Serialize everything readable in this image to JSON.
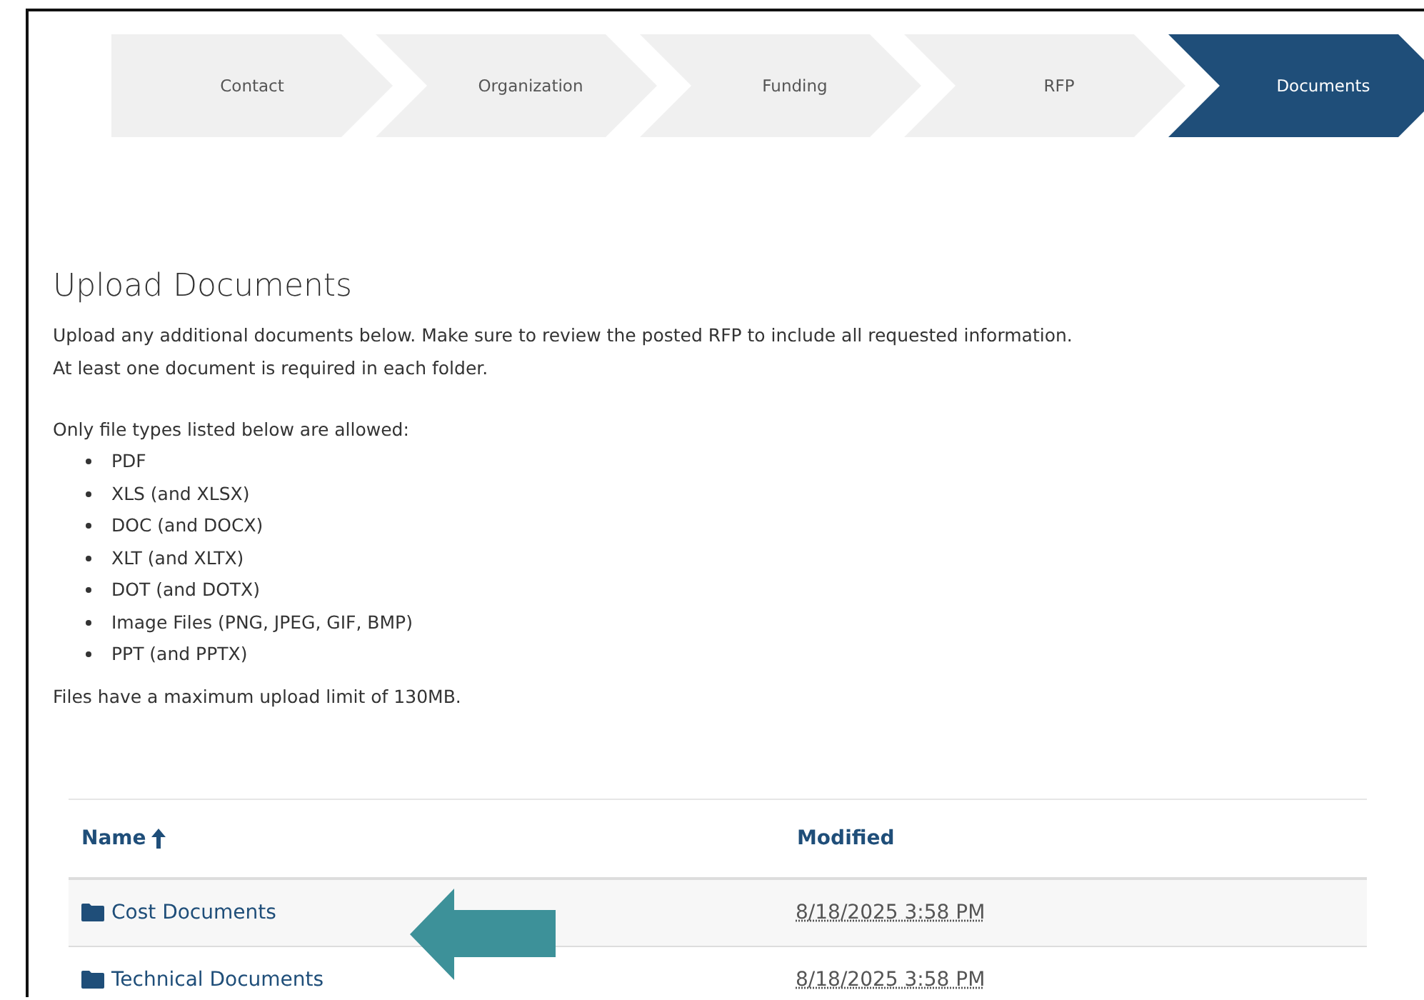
{
  "steps": [
    {
      "label": "Contact",
      "selected": false
    },
    {
      "label": "Organization",
      "selected": false
    },
    {
      "label": "Funding",
      "selected": false
    },
    {
      "label": "RFP",
      "selected": false
    },
    {
      "label": "Documents",
      "selected": true
    }
  ],
  "heading": "Upload Documents",
  "intro": [
    "Upload any additional documents below. Make sure to review the posted RFP to include all requested information.",
    "At least one document is required in each folder."
  ],
  "types_intro": "Only file types listed below are allowed:",
  "file_types": [
    "PDF",
    "XLS (and XLSX)",
    "DOC (and DOCX)",
    "XLT (and XLTX)",
    "DOT (and DOTX)",
    "Image Files (PNG, JPEG, GIF, BMP)",
    "PPT (and PPTX)"
  ],
  "limit_note": "Files have a maximum upload limit of 130MB.",
  "table": {
    "columns": [
      {
        "label": "Name",
        "sorted": true
      },
      {
        "label": "Modified",
        "sorted": false
      }
    ],
    "rows": [
      {
        "name": "Cost Documents",
        "modified": "8/18/2025 3:58 PM"
      },
      {
        "name": "Technical Documents",
        "modified": "8/18/2025 3:58 PM"
      }
    ]
  }
}
